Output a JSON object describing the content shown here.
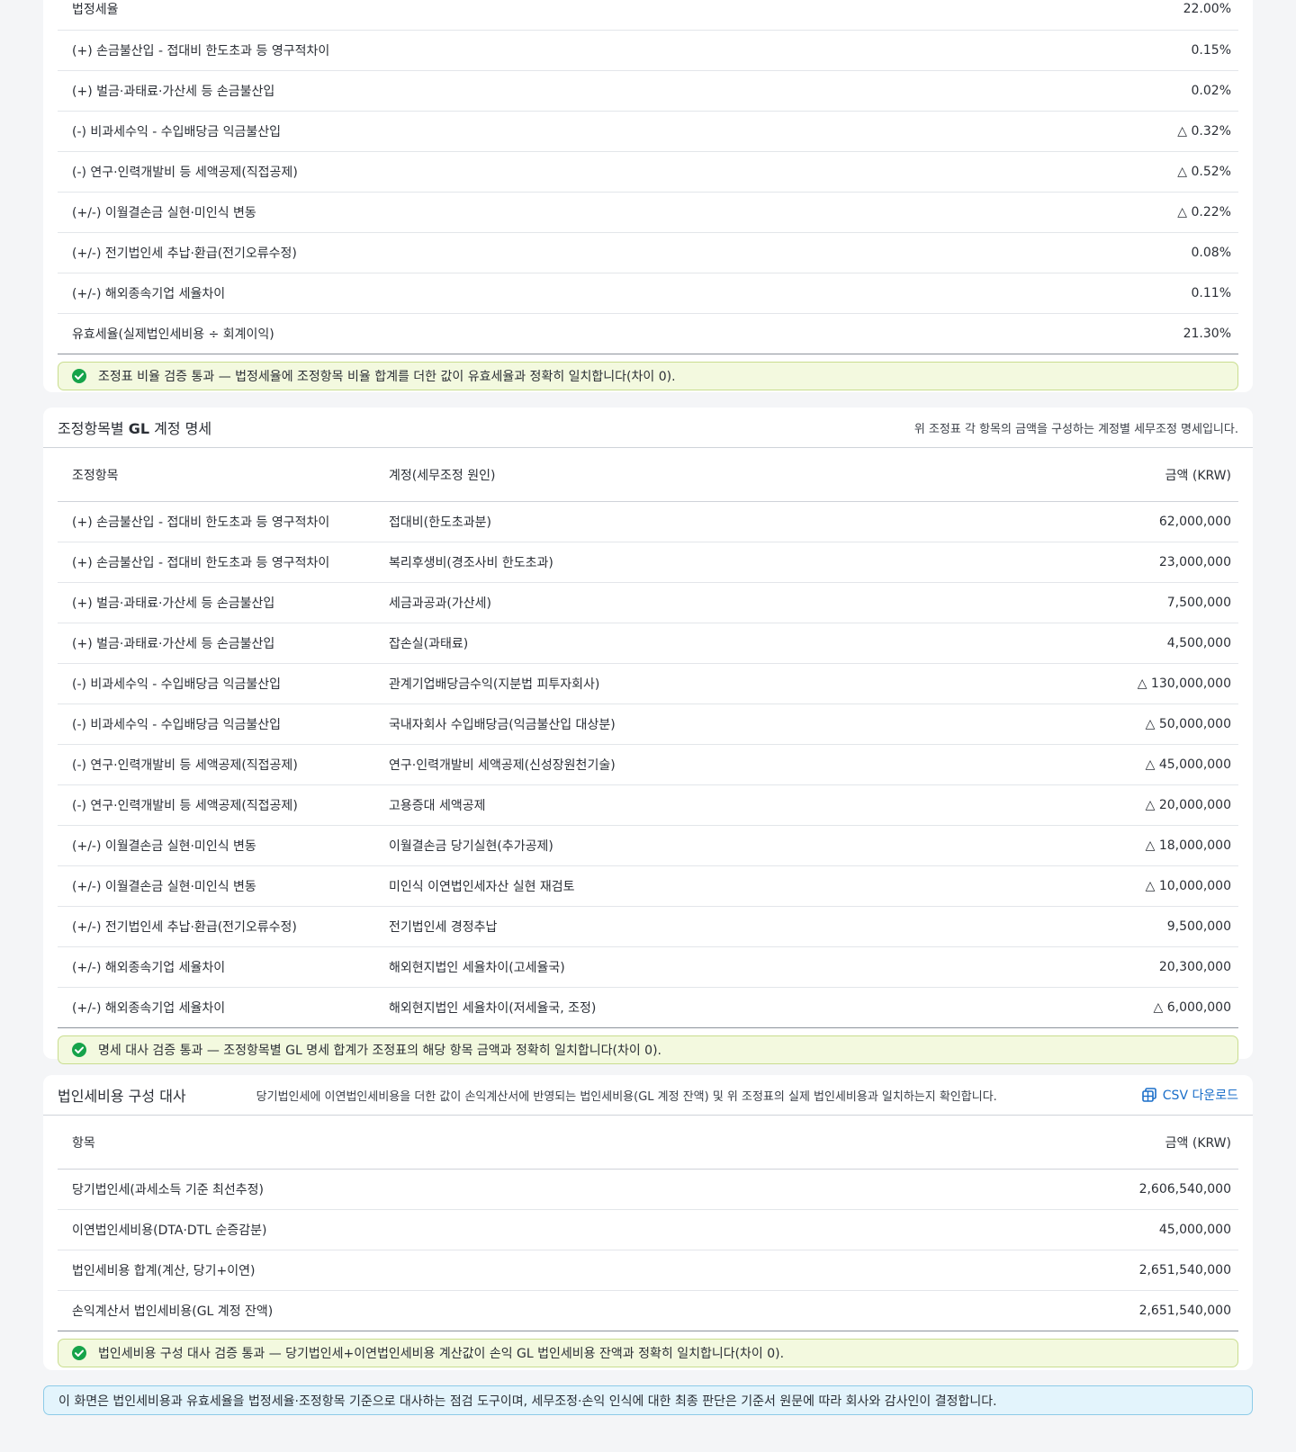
{
  "ratio_table": {
    "rows": [
      {
        "label": "법정세율",
        "value": "22.00%"
      },
      {
        "label": "(+) 손금불산입 - 접대비 한도초과 등 영구적차이",
        "value": "0.15%"
      },
      {
        "label": "(+) 벌금·과태료·가산세 등 손금불산입",
        "value": "0.02%"
      },
      {
        "label": "(-) 비과세수익 - 수입배당금 익금불산입",
        "value": "△ 0.32%"
      },
      {
        "label": "(-) 연구·인력개발비 등 세액공제(직접공제)",
        "value": "△ 0.52%"
      },
      {
        "label": "(+/-) 이월결손금 실현·미인식 변동",
        "value": "△ 0.22%"
      },
      {
        "label": "(+/-) 전기법인세 추납·환급(전기오류수정)",
        "value": "0.08%"
      },
      {
        "label": "(+/-) 해외종속기업 세율차이",
        "value": "0.11%"
      },
      {
        "label": "유효세율(실제법인세비용 ÷ 회계이익)",
        "value": "21.30%"
      }
    ],
    "check_text": "조정표 비율 검증 통과 — 법정세율에 조정항목 비율 합계를 더한 값이 유효세율과 정확히 일치합니다(차이 0)."
  },
  "gl_detail": {
    "title_prefix": "조정항목별 ",
    "title_bold": "GL",
    "title_suffix": " 계정 명세",
    "description": "위 조정표 각 항목의 금액을 구성하는 계정별 세무조정 명세입니다.",
    "headers": {
      "item": "조정항목",
      "account": "계정(세무조정 원인)",
      "amount": "금액 (KRW)"
    },
    "rows": [
      {
        "item": "(+) 손금불산입 - 접대비 한도초과 등 영구적차이",
        "account": "접대비(한도초과분)",
        "amount": "62,000,000"
      },
      {
        "item": "(+) 손금불산입 - 접대비 한도초과 등 영구적차이",
        "account": "복리후생비(경조사비 한도초과)",
        "amount": "23,000,000"
      },
      {
        "item": "(+) 벌금·과태료·가산세 등 손금불산입",
        "account": "세금과공과(가산세)",
        "amount": "7,500,000"
      },
      {
        "item": "(+) 벌금·과태료·가산세 등 손금불산입",
        "account": "잡손실(과태료)",
        "amount": "4,500,000"
      },
      {
        "item": "(-) 비과세수익 - 수입배당금 익금불산입",
        "account": "관계기업배당금수익(지분법 피투자회사)",
        "amount": "△ 130,000,000"
      },
      {
        "item": "(-) 비과세수익 - 수입배당금 익금불산입",
        "account": "국내자회사 수입배당금(익금불산입 대상분)",
        "amount": "△ 50,000,000"
      },
      {
        "item": "(-) 연구·인력개발비 등 세액공제(직접공제)",
        "account": "연구·인력개발비 세액공제(신성장원천기술)",
        "amount": "△ 45,000,000"
      },
      {
        "item": "(-) 연구·인력개발비 등 세액공제(직접공제)",
        "account": "고용증대 세액공제",
        "amount": "△ 20,000,000"
      },
      {
        "item": "(+/-) 이월결손금 실현·미인식 변동",
        "account": "이월결손금 당기실현(추가공제)",
        "amount": "△ 18,000,000"
      },
      {
        "item": "(+/-) 이월결손금 실현·미인식 변동",
        "account": "미인식 이연법인세자산 실현 재검토",
        "amount": "△ 10,000,000"
      },
      {
        "item": "(+/-) 전기법인세 추납·환급(전기오류수정)",
        "account": "전기법인세 경정추납",
        "amount": "9,500,000"
      },
      {
        "item": "(+/-) 해외종속기업 세율차이",
        "account": "해외현지법인 세율차이(고세율국)",
        "amount": "20,300,000"
      },
      {
        "item": "(+/-) 해외종속기업 세율차이",
        "account": "해외현지법인 세율차이(저세율국, 조정)",
        "amount": "△ 6,000,000"
      }
    ],
    "check_text": "명세 대사 검증 통과 — 조정항목별 GL 명세 합계가 조정표의 해당 항목 금액과 정확히 일치합니다(차이 0)."
  },
  "tax_expense": {
    "title": "법인세비용 구성 대사",
    "description": "당기법인세에 이연법인세비용을 더한 값이 손익계산서에 반영되는 법인세비용(GL 계정 잔액) 및 위 조정표의 실제 법인세비용과 일치하는지 확인합니다.",
    "csv_label": "CSV 다운로드",
    "headers": {
      "item": "항목",
      "amount": "금액 (KRW)"
    },
    "rows": [
      {
        "item": "당기법인세(과세소득 기준 최선추정)",
        "amount": "2,606,540,000"
      },
      {
        "item": "이연법인세비용(DTA·DTL 순증감분)",
        "amount": "45,000,000"
      },
      {
        "item": "법인세비용 합계(계산, 당기+이연)",
        "amount": "2,651,540,000"
      },
      {
        "item": "손익계산서 법인세비용(GL 계정 잔액)",
        "amount": "2,651,540,000"
      }
    ],
    "check_text": "법인세비용 구성 대사 검증 통과 — 당기법인세+이연법인세비용 계산값이 손익 GL 법인세비용 잔액과 정확히 일치합니다(차이 0)."
  },
  "notice": "이 화면은 법인세비용과 유효세율을 법정세율·조정항목 기준으로 대사하는 점검 도구이며, 세무조정·손익 인식에 대한 최종 판단은 기준서 원문에 따라 회사와 감사인이 결정합니다.",
  "colors": {
    "success": "#16a34a",
    "link": "#1a6ec9",
    "ok_bg": "#f3f9df",
    "notice_bg": "#e3f4fc"
  }
}
